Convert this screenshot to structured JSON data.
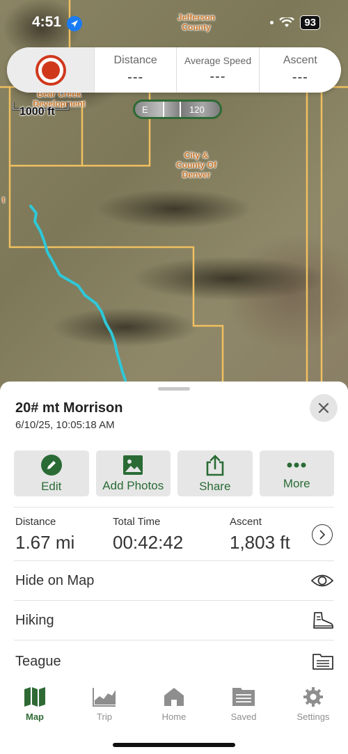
{
  "status": {
    "time": "4:51",
    "battery": "93"
  },
  "map": {
    "labels": {
      "county_top": "Jefferson County",
      "bear_creek": "Bear Creek Development",
      "city_denver": "City & County Of Denver",
      "edge_left": "t"
    },
    "scale": "1000 ft",
    "compass": {
      "letter": "E",
      "degrees": "120"
    }
  },
  "stats": {
    "distance_label": "Distance",
    "distance_value": "---",
    "speed_label": "Average Speed",
    "speed_value": "---",
    "ascent_label": "Ascent",
    "ascent_value": "---"
  },
  "track": {
    "title": "20# mt Morrison",
    "date": "6/10/25, 10:05:18 AM"
  },
  "actions": [
    {
      "label": "Edit",
      "icon": "pencil-icon"
    },
    {
      "label": "Add Photos",
      "icon": "photo-icon"
    },
    {
      "label": "Share",
      "icon": "share-icon"
    },
    {
      "label": "More",
      "icon": "more-icon"
    }
  ],
  "summary": {
    "distance_label": "Distance",
    "distance_value": "1.67 mi",
    "time_label": "Total Time",
    "time_value": "00:42:42",
    "ascent_label": "Ascent",
    "ascent_value": "1,803 ft"
  },
  "rows": [
    {
      "label": "Hide on Map",
      "icon": "eye-icon"
    },
    {
      "label": "Hiking",
      "icon": "hiking-boot-icon"
    },
    {
      "label": "Teague",
      "icon": "folder-icon"
    }
  ],
  "tabs": [
    {
      "label": "Map",
      "icon": "map-icon",
      "active": true
    },
    {
      "label": "Trip",
      "icon": "trip-chart-icon",
      "active": false
    },
    {
      "label": "Home",
      "icon": "home-icon",
      "active": false
    },
    {
      "label": "Saved",
      "icon": "saved-folder-icon",
      "active": false
    },
    {
      "label": "Settings",
      "icon": "gear-icon",
      "active": false
    }
  ],
  "colors": {
    "accent": "#2f6a35",
    "record": "#d0381c",
    "track_line": "#2ec8d8",
    "boundary": "#f0c060"
  }
}
